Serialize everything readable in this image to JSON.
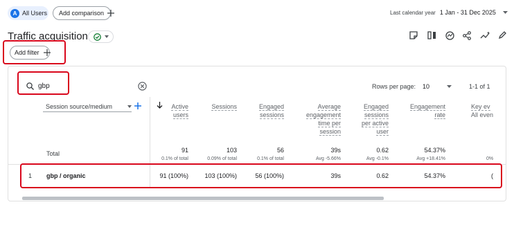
{
  "topbar": {
    "segment_letter": "A",
    "segment_label": "All Users",
    "add_comparison_label": "Add comparison",
    "date_range_label": "Last calendar year",
    "date_range_value": "1 Jan - 31 Dec 2025"
  },
  "page": {
    "title": "Traffic acquisition",
    "add_filter_label": "Add filter"
  },
  "table": {
    "search_value": "gbp",
    "rows_per_page_label": "Rows per page:",
    "rows_per_page_value": "10",
    "pagination": "1-1 of 1",
    "dimension_label": "Session source/medium",
    "columns": [
      {
        "lines": [
          "Active",
          "users"
        ]
      },
      {
        "lines": [
          "Sessions"
        ]
      },
      {
        "lines": [
          "Engaged",
          "sessions"
        ]
      },
      {
        "lines": [
          "Average",
          "engagement",
          "time per",
          "session"
        ]
      },
      {
        "lines": [
          "Engaged",
          "sessions",
          "per active",
          "user"
        ]
      },
      {
        "lines": [
          "Engagement",
          "rate"
        ]
      },
      {
        "lines": [
          "Key ev",
          "All even"
        ]
      }
    ],
    "total_label": "Total",
    "totals": [
      {
        "value": "91",
        "sub": "0.1% of total"
      },
      {
        "value": "103",
        "sub": "0.09% of total"
      },
      {
        "value": "56",
        "sub": "0.1% of total"
      },
      {
        "value": "39s",
        "sub": "Avg -5.66%"
      },
      {
        "value": "0.62",
        "sub": "Avg -0.1%"
      },
      {
        "value": "54.37%",
        "sub": "Avg +18.41%"
      },
      {
        "value": "",
        "sub": "0%"
      }
    ],
    "rows": [
      {
        "index": "1",
        "dimension": "gbp / organic",
        "cells": [
          "91 (100%)",
          "103 (100%)",
          "56 (100%)",
          "39s",
          "0.62",
          "54.37%",
          "("
        ]
      }
    ]
  },
  "colors": {
    "accent": "#1a73e8",
    "highlight_box": "#d9071c",
    "segment_chip": "#e8f0fe",
    "status_green": "#188038"
  }
}
